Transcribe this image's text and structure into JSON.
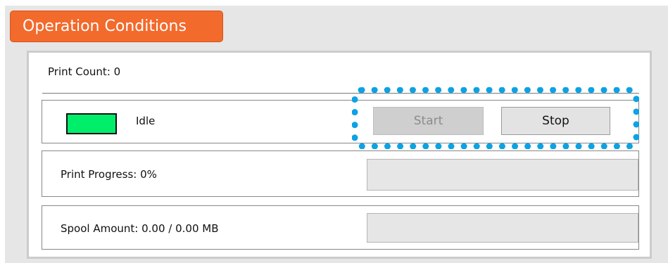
{
  "section": {
    "title": "Operation Conditions"
  },
  "print_count": {
    "label": "Print Count:",
    "value": "0",
    "text": "Print Count:  0"
  },
  "status": {
    "indicator_color": "#00ee6a",
    "text": "Idle"
  },
  "buttons": {
    "start": {
      "label": "Start",
      "enabled": false
    },
    "stop": {
      "label": "Stop",
      "enabled": true
    }
  },
  "progress": {
    "label": "Print Progress:",
    "value": "0%",
    "text": "Print Progress:  0%",
    "fraction": 0
  },
  "spool": {
    "label": "Spool Amount:",
    "value": "0.00 / 0.00 MB",
    "text": "Spool Amount:  0.00 / 0.00 MB",
    "fraction": 0
  },
  "colors": {
    "tab_background": "#f26a2c",
    "highlight_frame": "#0da2e3",
    "status_idle": "#00ee6a"
  }
}
